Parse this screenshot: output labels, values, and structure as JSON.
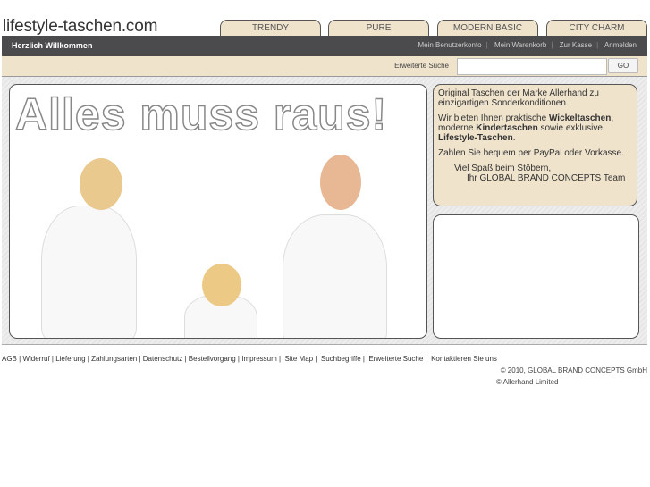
{
  "logo": "lifestyle-taschen.com",
  "tabs": [
    "TRENDY",
    "PURE",
    "MODERN BASIC",
    "CITY CHARM"
  ],
  "nav": {
    "welcome": "Herzlich Willkommen",
    "links": [
      "Mein Benutzerkonto",
      "Mein Warenkorb",
      "Zur Kasse",
      "Anmelden"
    ]
  },
  "search": {
    "label": "Erweiterte Suche",
    "value": "",
    "button": "GO"
  },
  "hero": {
    "headline": "Alles muss raus!"
  },
  "info": {
    "p1": "Original Taschen der Marke Allerhand zu einzigartigen Sonderkonditionen.",
    "p2a": "Wir bieten Ihnen praktische ",
    "p2b": "Wickeltaschen",
    "p2c": ", moderne ",
    "p2d": "Kindertaschen",
    "p2e": " sowie exklusive ",
    "p2f": "Lifestyle-Taschen",
    "p2g": ".",
    "p3": "Zahlen Sie bequem per PayPal oder Vorkasse.",
    "sign1": "Viel Spaß beim Stöbern,",
    "sign2": "Ihr GLOBAL BRAND CONCEPTS Team"
  },
  "footer": {
    "links": [
      "AGB",
      "Widerruf",
      "Lieferung",
      "Zahlungsarten",
      "Datenschutz",
      "Bestellvorgang",
      "Impressum",
      "Site Map",
      "Suchbegriffe",
      "Erweiterte Suche",
      "Kontaktieren Sie uns"
    ],
    "copy1": "© 2010, GLOBAL BRAND CONCEPTS GmbH",
    "copy2": "© Allerhand Limited"
  }
}
